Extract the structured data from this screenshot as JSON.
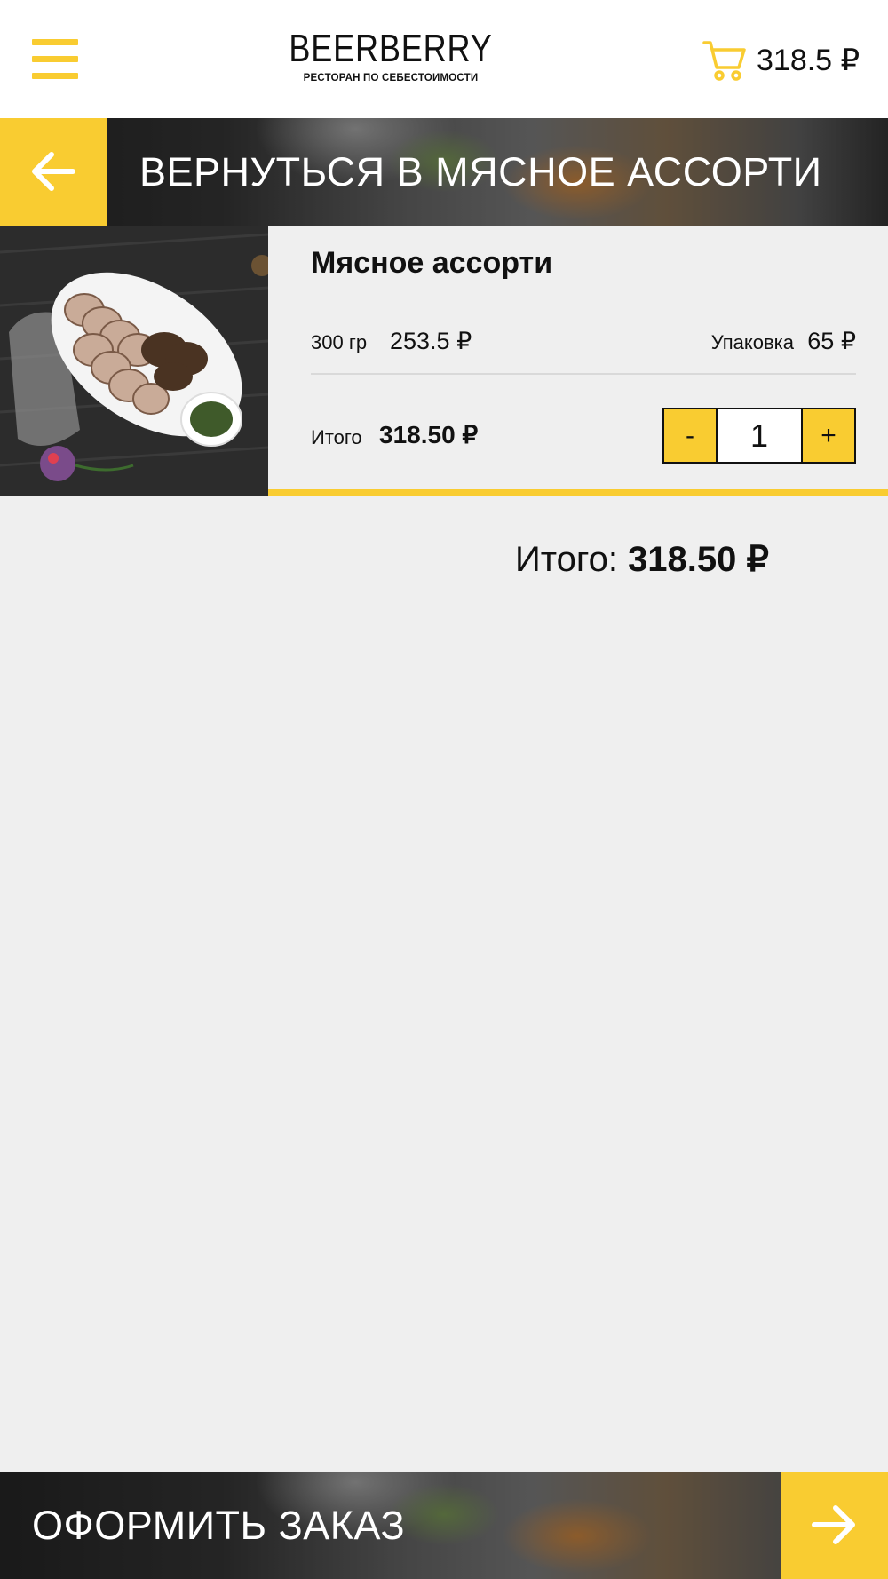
{
  "header": {
    "menu_icon": "hamburger-menu-icon",
    "logo_name": "BEERBERRY",
    "logo_tagline": "РЕСТОРАН ПО СЕБЕСТОИМОСТИ",
    "cart_icon": "shopping-cart-icon",
    "cart_total": "318.5 ₽"
  },
  "back_nav": {
    "icon": "arrow-left-icon",
    "label": "ВЕРНУТЬСЯ В МЯСНОЕ АССОРТИ"
  },
  "cart_item": {
    "name": "Мясное ассорти",
    "weight": "300 гр",
    "price": "253.5 ₽",
    "packaging_label": "Упаковка",
    "packaging_price": "65 ₽",
    "subtotal_label": "Итого",
    "subtotal": "318.50 ₽",
    "quantity": {
      "minus_label": "-",
      "value": "1",
      "plus_label": "+"
    }
  },
  "summary": {
    "total_label": "Итого:",
    "total_value": "318.50 ₽"
  },
  "checkout": {
    "label": "ОФОРМИТЬ ЗАКАЗ",
    "icon": "arrow-right-icon"
  },
  "colors": {
    "accent": "#f9cc31",
    "background": "#efefef",
    "header_bg": "#ffffff",
    "text": "#111111"
  }
}
